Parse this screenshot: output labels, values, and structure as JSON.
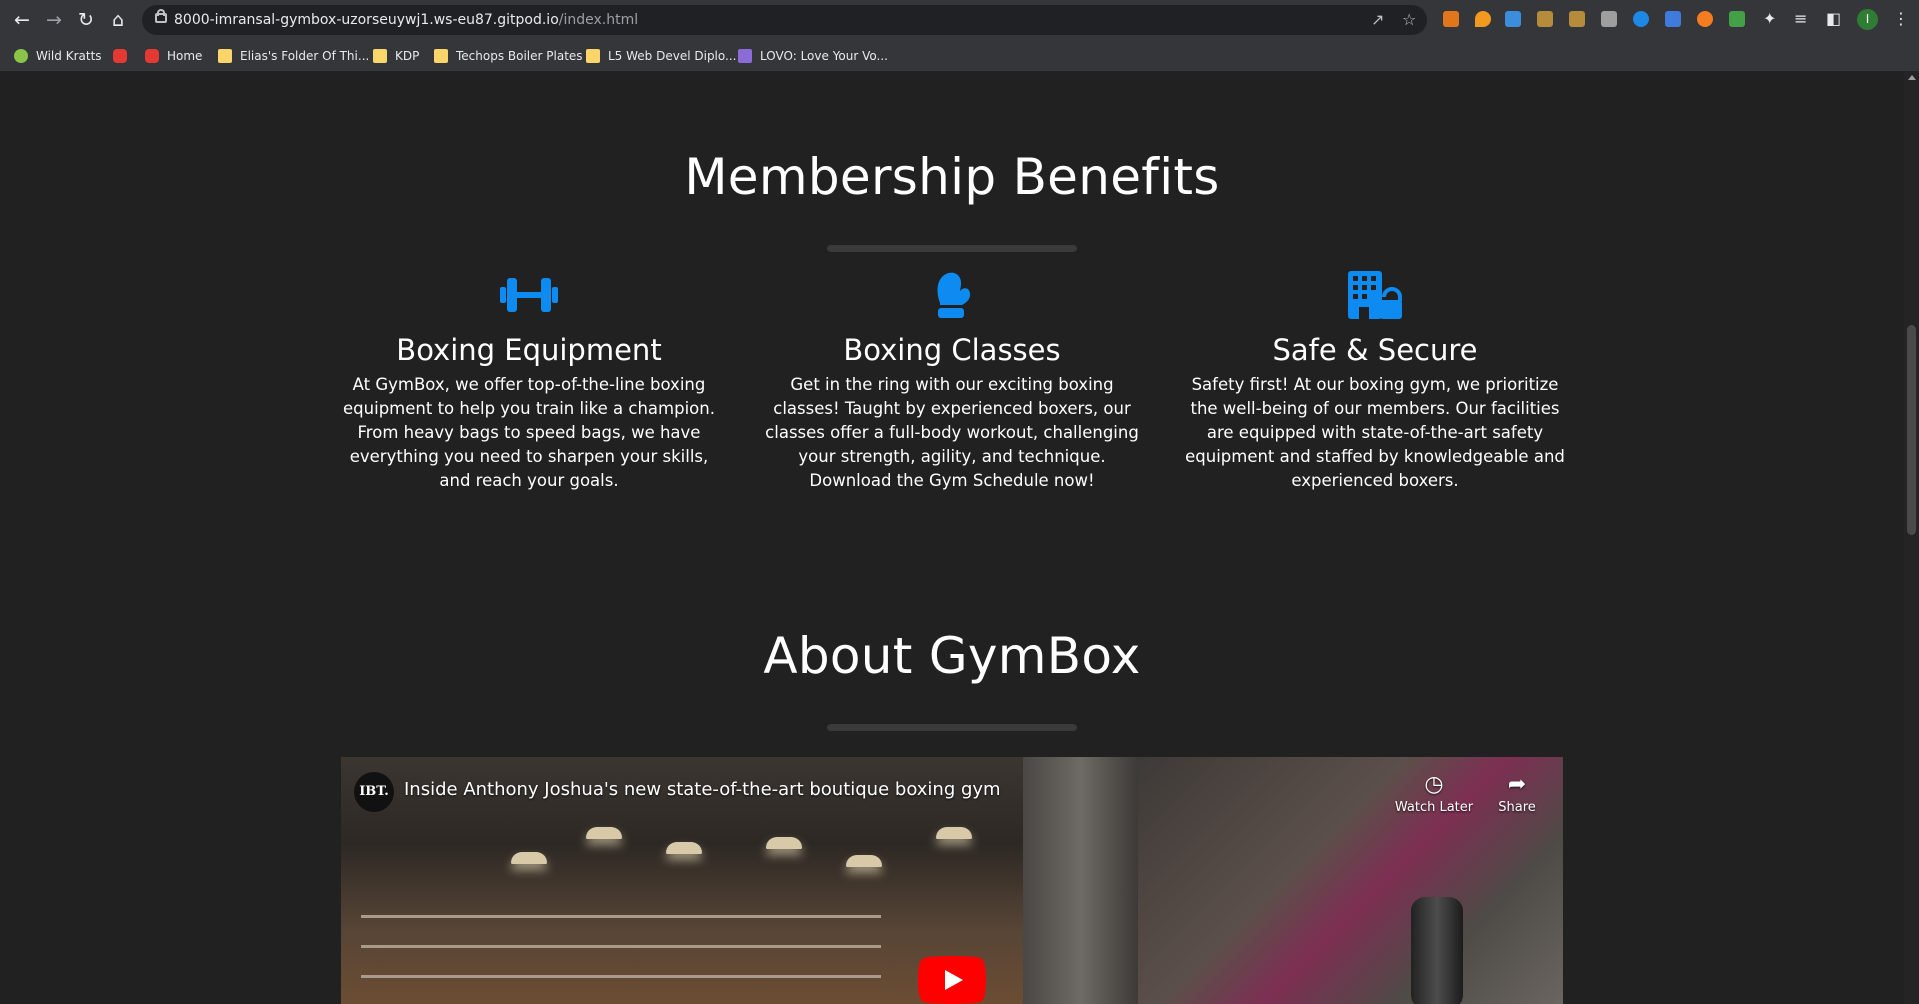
{
  "browser": {
    "url_domain": "8000-imransal-gymbox-uzorseuywj1.ws-eu87.gitpod.io",
    "url_path": "/index.html",
    "profile_initial": "I",
    "bookmarks": [
      {
        "label": "Wild Kratts",
        "icon": "globe-icon"
      },
      {
        "label": "",
        "icon": "youtube-icon"
      },
      {
        "label": "Home",
        "icon": "youtube-icon"
      },
      {
        "label": "Elias's Folder Of Thi...",
        "icon": "folder-icon"
      },
      {
        "label": "KDP",
        "icon": "folder-icon"
      },
      {
        "label": "Techops Boiler Plates",
        "icon": "folder-icon"
      },
      {
        "label": "L5 Web Devel Diplo...",
        "icon": "folder-icon"
      },
      {
        "label": "LOVO: Love Your Vo...",
        "icon": "waveform-icon"
      }
    ]
  },
  "colors": {
    "page_bg": "#212121",
    "accent_blue": "#0d8bf0",
    "text": "#ffffff",
    "divider": "#3a3a3a"
  },
  "membership": {
    "title": "Membership Benefits",
    "benefits": [
      {
        "icon": "dumbbell-icon",
        "title": "Boxing Equipment",
        "text": "At GymBox, we offer top-of-the-line boxing equipment to help you train like a champion. From heavy bags to speed bags, we have everything you need to sharpen your skills, and reach your goals."
      },
      {
        "icon": "mitten-icon",
        "title": "Boxing Classes",
        "text": "Get in the ring with our exciting boxing classes! Taught by experienced boxers, our classes offer a full-body workout, challenging your strength, agility, and technique. Download the Gym Schedule now!"
      },
      {
        "icon": "building-lock-icon",
        "title": "Safe & Secure",
        "text": "Safety first! At our boxing gym, we prioritize the well-being of our members. Our facilities are equipped with state-of-the-art safety equipment and staffed by knowledgeable and experienced boxers."
      }
    ]
  },
  "about": {
    "title": "About GymBox",
    "video": {
      "channel_logo": "IBT.",
      "title": "Inside Anthony Joshua's new state-of-the-art boutique boxing gym",
      "watch_later": "Watch Later",
      "share": "Share"
    }
  }
}
